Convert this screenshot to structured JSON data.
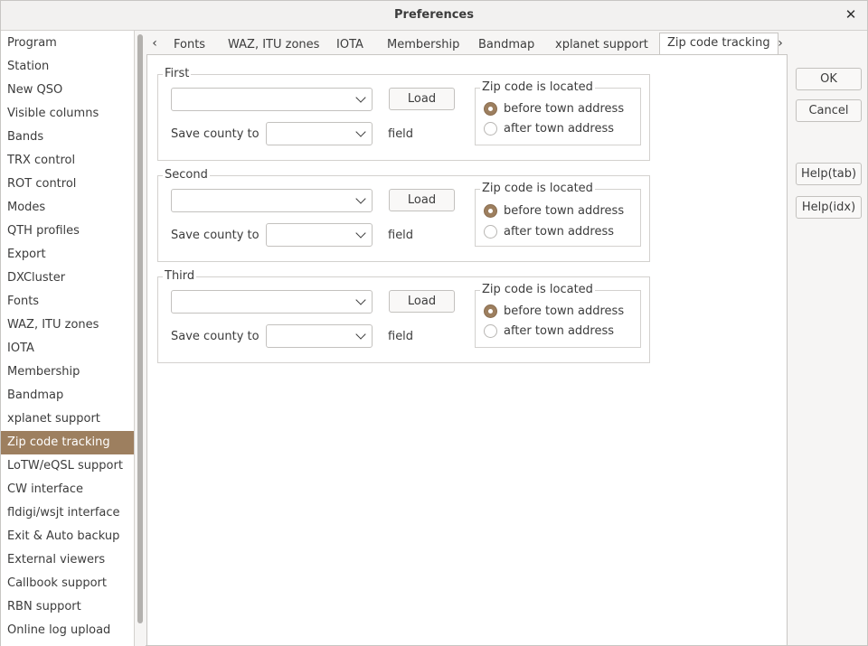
{
  "window": {
    "title": "Preferences",
    "close_glyph": "✕"
  },
  "sidebar": {
    "selected_index": 17,
    "items": [
      "Program",
      "Station",
      "New QSO",
      "Visible columns",
      "Bands",
      "TRX control",
      "ROT control",
      "Modes",
      "QTH profiles",
      "Export",
      "DXCluster",
      "Fonts",
      "WAZ, ITU zones",
      "IOTA",
      "Membership",
      "Bandmap",
      "xplanet support",
      "Zip code tracking",
      "LoTW/eQSL support",
      "CW interface",
      "fldigi/wsjt interface",
      "Exit & Auto backup",
      "External viewers",
      "Callbook support",
      "RBN support",
      "Online log upload"
    ]
  },
  "tabs": {
    "left_arrow": "‹",
    "right_arrow": "›",
    "items": [
      "Fonts",
      "WAZ, ITU zones",
      "IOTA",
      "Membership",
      "Bandmap",
      "xplanet support",
      "Zip code tracking"
    ],
    "active": "Zip code tracking"
  },
  "groups": [
    {
      "title": "First",
      "zip_value": "",
      "load_label": "Load",
      "save_county_label": "Save county to",
      "county_field_value": "",
      "field_label": "field",
      "located_title": "Zip code is located",
      "option_before": "before town address",
      "option_after": "after town address",
      "selected": "before"
    },
    {
      "title": "Second",
      "zip_value": "",
      "load_label": "Load",
      "save_county_label": "Save county to",
      "county_field_value": "",
      "field_label": "field",
      "located_title": "Zip code is located",
      "option_before": "before town address",
      "option_after": "after town address",
      "selected": "before"
    },
    {
      "title": "Third",
      "zip_value": "",
      "load_label": "Load",
      "save_county_label": "Save county to",
      "county_field_value": "",
      "field_label": "field",
      "located_title": "Zip code is located",
      "option_before": "before town address",
      "option_after": "after town address",
      "selected": "before"
    }
  ],
  "buttons": {
    "ok": "OK",
    "cancel": "Cancel",
    "help_tab": "Help(tab)",
    "help_idx": "Help(idx)"
  },
  "colors": {
    "accent": "#9d7f5f"
  }
}
